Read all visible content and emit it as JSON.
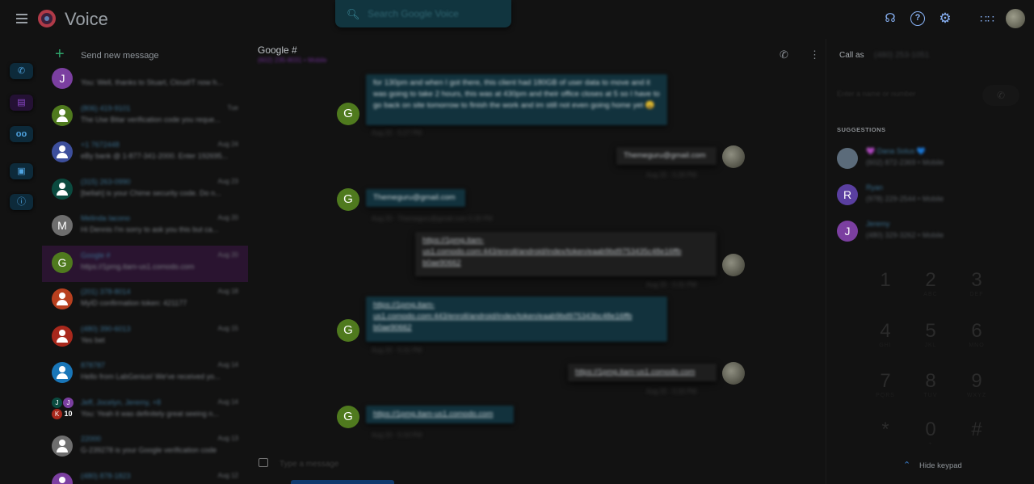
{
  "app": {
    "title": "Voice"
  },
  "search": {
    "placeholder": "Search Google Voice"
  },
  "header_icons": [
    "support-icon",
    "help-icon",
    "settings-icon",
    "apps-icon"
  ],
  "sidebar": {
    "new_message_label": "Send new message"
  },
  "conversations": [
    {
      "initial": "J",
      "color": "#7b3fa0",
      "name": "",
      "date": "",
      "snippet": "You: Well, thanks to Stuart, Cloud!T now h..."
    },
    {
      "initial": "",
      "color": "#4f7a1e",
      "name": "(806) 419-9101",
      "date": "Tue",
      "snippet": "The Use Bitar verification code you reque..."
    },
    {
      "initial": "",
      "color": "#3d4f9c",
      "name": "+1 7672448",
      "date": "Aug 24",
      "snippet": "eBy bank @ 1-877-341-2000. Enter 192695..."
    },
    {
      "initial": "",
      "color": "#0b4a3f",
      "name": "(315) 263-0990",
      "date": "Aug 23",
      "snippet": "[bellah] is your Chime security code. Do n..."
    },
    {
      "initial": "M",
      "color": "#6e6e6e",
      "name": "Melinda Iacono",
      "date": "Aug 20",
      "snippet": "Hi Dennis I'm sorry to ask you this but ca..."
    },
    {
      "initial": "G",
      "color": "#4f7a1e",
      "name": "Google #",
      "date": "Aug 20",
      "snippet": "https://1pmg.itam-us1.comodo.com"
    },
    {
      "initial": "",
      "color": "#b8401f",
      "name": "(201) 378-8014",
      "date": "Aug 18",
      "snippet": "MyID confirmation token: 421177"
    },
    {
      "initial": "",
      "color": "#a8281c",
      "name": "(480) 390-6013",
      "date": "Aug 15",
      "snippet": "Yes bet"
    },
    {
      "initial": "",
      "color": "#1976b8",
      "name": "878787",
      "date": "Aug 14",
      "snippet": "Hello from LabGenius! We've received yo..."
    },
    {
      "initial": "",
      "color": "",
      "name": "Jeff, Jocelyn, Jeremy, +8",
      "date": "Aug 14",
      "snippet": "You: Yeah it was definitely great seeing n..."
    },
    {
      "initial": "",
      "color": "#6e6e6e",
      "name": "22000",
      "date": "Aug 13",
      "snippet": "G-239278 is your Google verification code"
    },
    {
      "initial": "",
      "color": "#7b3fa0",
      "name": "(480) 878-1823",
      "date": "Aug 12",
      "snippet": ""
    }
  ],
  "group_avatar": {
    "a": "J",
    "b": "J",
    "c": "K",
    "count": "10"
  },
  "thread": {
    "title": "Google #",
    "number": "(602) 235-8031 • Mobile",
    "avatar_initial": "G",
    "messages": [
      {
        "dir": "in",
        "text": "for 130pm and when I got there, this client had 180GB of user data to move and it was going to take 2 hours, this was at 430pm and their office closes at 5 so I have to go back on site tomorrow to finish the work and im still not even going home yet 😩"
      },
      {
        "dir": "out",
        "text": "Themeguru@gmail.com"
      },
      {
        "dir": "in",
        "text": "Themeguru@gmail.com"
      },
      {
        "dir": "out",
        "text": "https://1pmg.itam-us1.comodo.com:443/enroll/android/index/token/eaab9bd9753435c48e16ffb b0ae90662"
      },
      {
        "dir": "in",
        "text": "https://1pmg.itam-us1.comodo.com:443/enroll/android/index/token/eaab9bd975343bc48e16ffb b0ae90662"
      },
      {
        "dir": "out",
        "text": "https://1pmg.itam-us1.comodo.com"
      },
      {
        "dir": "in",
        "text": "https://1pmg.itam-us1.comodo.com"
      }
    ],
    "meta": {
      "m1": "Aug 20 · 5:27 PM",
      "m2": "Aug 20 · 5:28 PM",
      "m3": "Aug 20 · Themeguru@gmail.com 5:29 PM",
      "m4": "Aug 20 · 5:31 PM",
      "m5": "Aug 20 · 5:31 PM",
      "m6": "Aug 20 · 5:33 PM",
      "m7": "Aug 20 · 5:33 PM"
    },
    "composer_placeholder": "Type a message"
  },
  "right_panel": {
    "call_as_label": "Call as",
    "call_as_number": "(480) 253-1051",
    "dial_placeholder": "Enter a name or number",
    "suggestions_label": "SUGGESTIONS",
    "suggestions": [
      {
        "initial": "",
        "color": "#5b6b7a",
        "name": "💜 Dana Solus 💙",
        "phone": "(602) 872-2369 • Mobile"
      },
      {
        "initial": "R",
        "color": "#5a3fa0",
        "name": "Ryan",
        "phone": "(978) 229-2544 • Mobile"
      },
      {
        "initial": "J",
        "color": "#7b3fa0",
        "name": "Jeremy",
        "phone": "(480) 329-3262 • Mobile"
      }
    ],
    "keypad": [
      {
        "d": "1",
        "l": ""
      },
      {
        "d": "2",
        "l": "ABC"
      },
      {
        "d": "3",
        "l": "DEF"
      },
      {
        "d": "4",
        "l": "GHI"
      },
      {
        "d": "5",
        "l": "JKL"
      },
      {
        "d": "6",
        "l": "MNO"
      },
      {
        "d": "7",
        "l": "PQRS"
      },
      {
        "d": "8",
        "l": "TUV"
      },
      {
        "d": "9",
        "l": "WXYZ"
      },
      {
        "d": "*",
        "l": ""
      },
      {
        "d": "0",
        "l": "+"
      },
      {
        "d": "#",
        "l": ""
      }
    ],
    "hide_keypad_label": "Hide keypad"
  },
  "colors": {
    "accent": "#8ab4f8",
    "active_conversation": "#2a1430",
    "incoming_bubble": "#12323d",
    "green_avatar": "#4f7a1e"
  }
}
